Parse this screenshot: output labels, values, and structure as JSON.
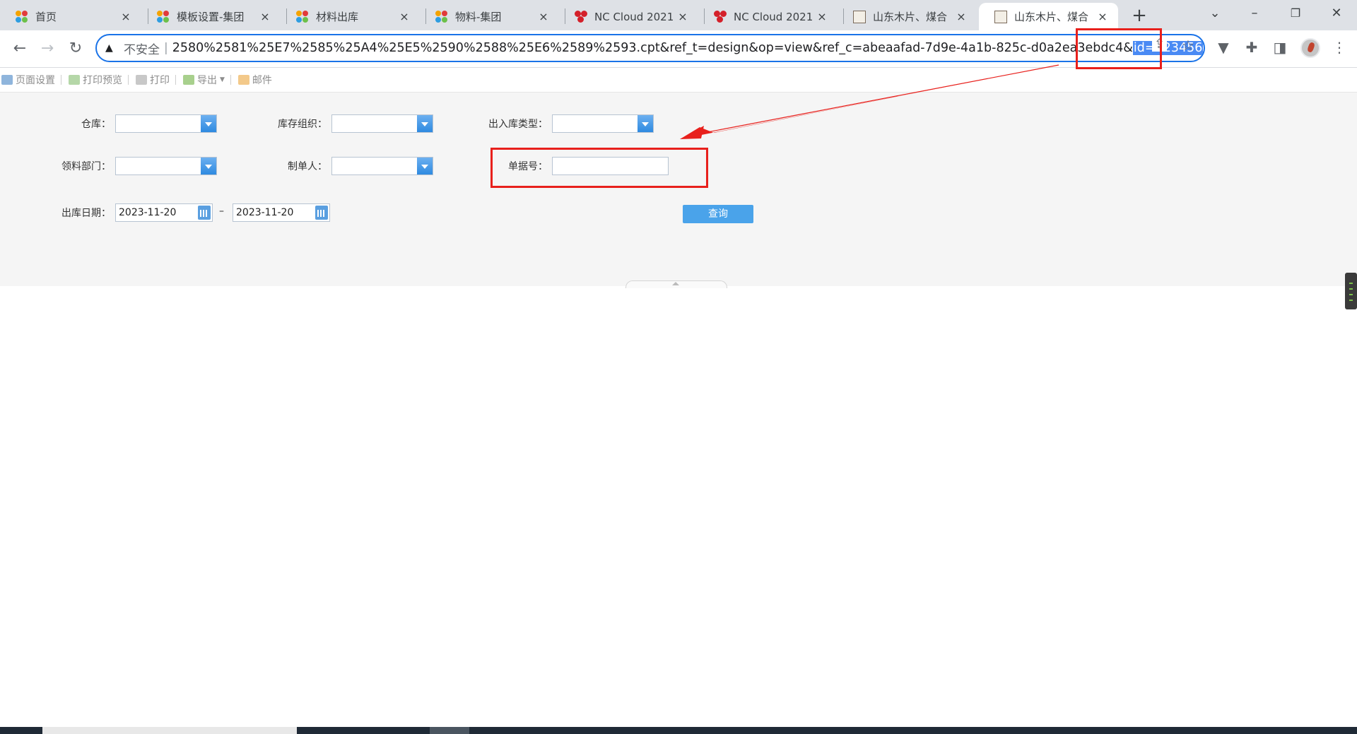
{
  "browser": {
    "tabs": [
      {
        "label": "首页",
        "favicon": "yonyou-dots-icon"
      },
      {
        "label": "模板设置-集团",
        "favicon": "yonyou-dots-icon"
      },
      {
        "label": "材料出库",
        "favicon": "yonyou-dots-icon"
      },
      {
        "label": "物料-集团",
        "favicon": "yonyou-dots-icon"
      },
      {
        "label": "NC Cloud 2021",
        "favicon": "nc-cloud-icon"
      },
      {
        "label": "NC Cloud 2021",
        "favicon": "nc-cloud-icon"
      },
      {
        "label": "山东木片、煤合",
        "favicon": "report-image-icon"
      },
      {
        "label": "山东木片、煤合",
        "favicon": "report-image-icon",
        "active": true
      }
    ],
    "tab_close": "×",
    "new_tab": "+",
    "window_controls": {
      "tab_search": "⌄",
      "minimize": "–",
      "restore": "❐",
      "close": "✕"
    },
    "address_bar": {
      "security_label": "不安全",
      "separator": "|",
      "url_visible": "2580%2581%25E7%2585%25A4%25E5%2590%2588%25E6%2589%2593.cpt&ref_t=design&op=view&ref_c=abeaafad-7d9e-4a1b-825c-d0a2ea3ebdc4&",
      "url_selected": "id=123456"
    }
  },
  "report_toolbar": {
    "page_setup": "页面设置",
    "print_preview": "打印预览",
    "print": "打印",
    "export": "导出",
    "mail": "邮件"
  },
  "form": {
    "warehouse_label": "仓库：",
    "stock_org_label": "库存组织：",
    "io_type_label": "出入库类型：",
    "dept_label": "领料部门：",
    "creator_label": "制单人：",
    "bill_no_label": "单据号：",
    "bill_no_value": "",
    "date_label": "出库日期：",
    "date_from": "2023-11-20",
    "date_to": "2023-11-20",
    "date_separator": "–",
    "query_button": "查询"
  },
  "colors": {
    "annotation_red": "#e8201c",
    "query_button": "#4aa3ea",
    "omnibox_focus": "#1a73e8"
  }
}
